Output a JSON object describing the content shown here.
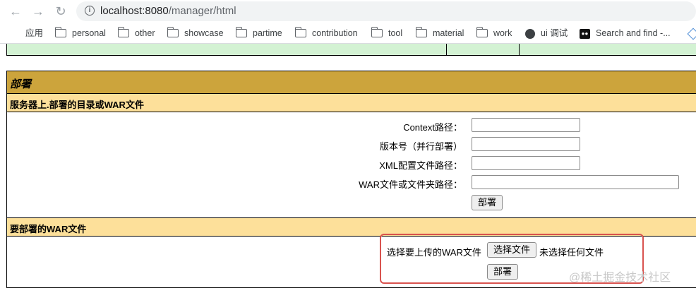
{
  "browser": {
    "url_host": "localhost:8080",
    "url_path": "/manager/html",
    "bookmarks": [
      {
        "label": "应用",
        "icon": "apps-grid-icon"
      },
      {
        "label": "personal",
        "icon": "folder-icon"
      },
      {
        "label": "other",
        "icon": "folder-icon"
      },
      {
        "label": "showcase",
        "icon": "folder-icon"
      },
      {
        "label": "partime",
        "icon": "folder-icon"
      },
      {
        "label": "contribution",
        "icon": "folder-icon"
      },
      {
        "label": "tool",
        "icon": "folder-icon"
      },
      {
        "label": "material",
        "icon": "folder-icon"
      },
      {
        "label": "work",
        "icon": "folder-icon"
      },
      {
        "label": "ui 调试",
        "icon": "globe-icon"
      },
      {
        "label": "Search and find -...",
        "icon": "square-logo-icon"
      }
    ]
  },
  "deploy": {
    "title": "部署",
    "server_section": "服务器上.部署的目录或WAR文件",
    "context_label": "Context路径：",
    "version_label": "版本号（并行部署）",
    "xml_label": "XML配置文件路径：",
    "war_path_label": "WAR文件或文件夹路径：",
    "context_value": "",
    "version_value": "",
    "xml_value": "",
    "war_path_value": "",
    "deploy_button": "部署",
    "upload_section": "要部署的WAR文件",
    "upload_label": "选择要上传的WAR文件",
    "choose_file_button": "选择文件",
    "no_file_text": "未选择任何文件",
    "upload_deploy_button": "部署"
  },
  "watermark": "@稀土掘金技术社区",
  "colors": {
    "title_bg": "#cca43c",
    "section_bg": "#fde09a",
    "prev_row_bg": "#d3f2d3",
    "highlight": "#d9534f"
  }
}
